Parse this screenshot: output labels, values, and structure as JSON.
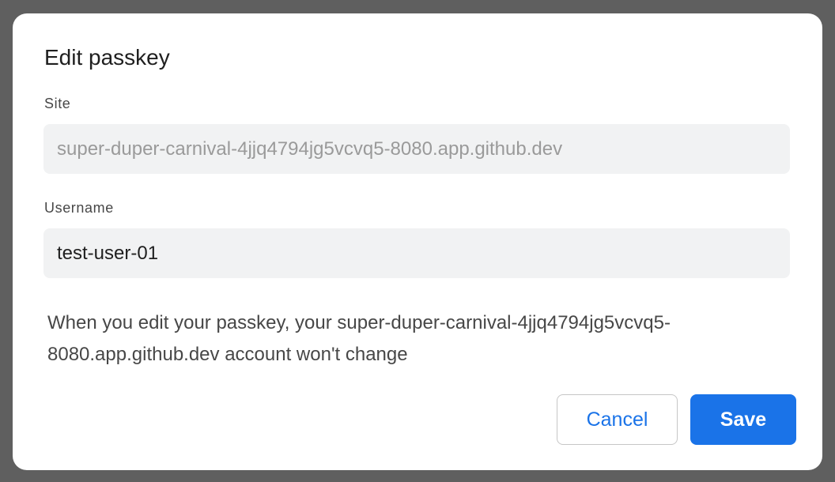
{
  "dialog": {
    "title": "Edit passkey",
    "site": {
      "label": "Site",
      "value": "super-duper-carnival-4jjq4794jg5vcvq5-8080.app.github.dev"
    },
    "username": {
      "label": "Username",
      "value": "test-user-01"
    },
    "note": "When you edit your passkey, your super-duper-carnival-4jjq4794jg5vcvq5-8080.app.github.dev account won't change",
    "buttons": {
      "cancel": "Cancel",
      "save": "Save"
    }
  },
  "colors": {
    "accent": "#1a73e8",
    "field_background": "#f1f2f3",
    "overlay": "#5f5f5f"
  }
}
